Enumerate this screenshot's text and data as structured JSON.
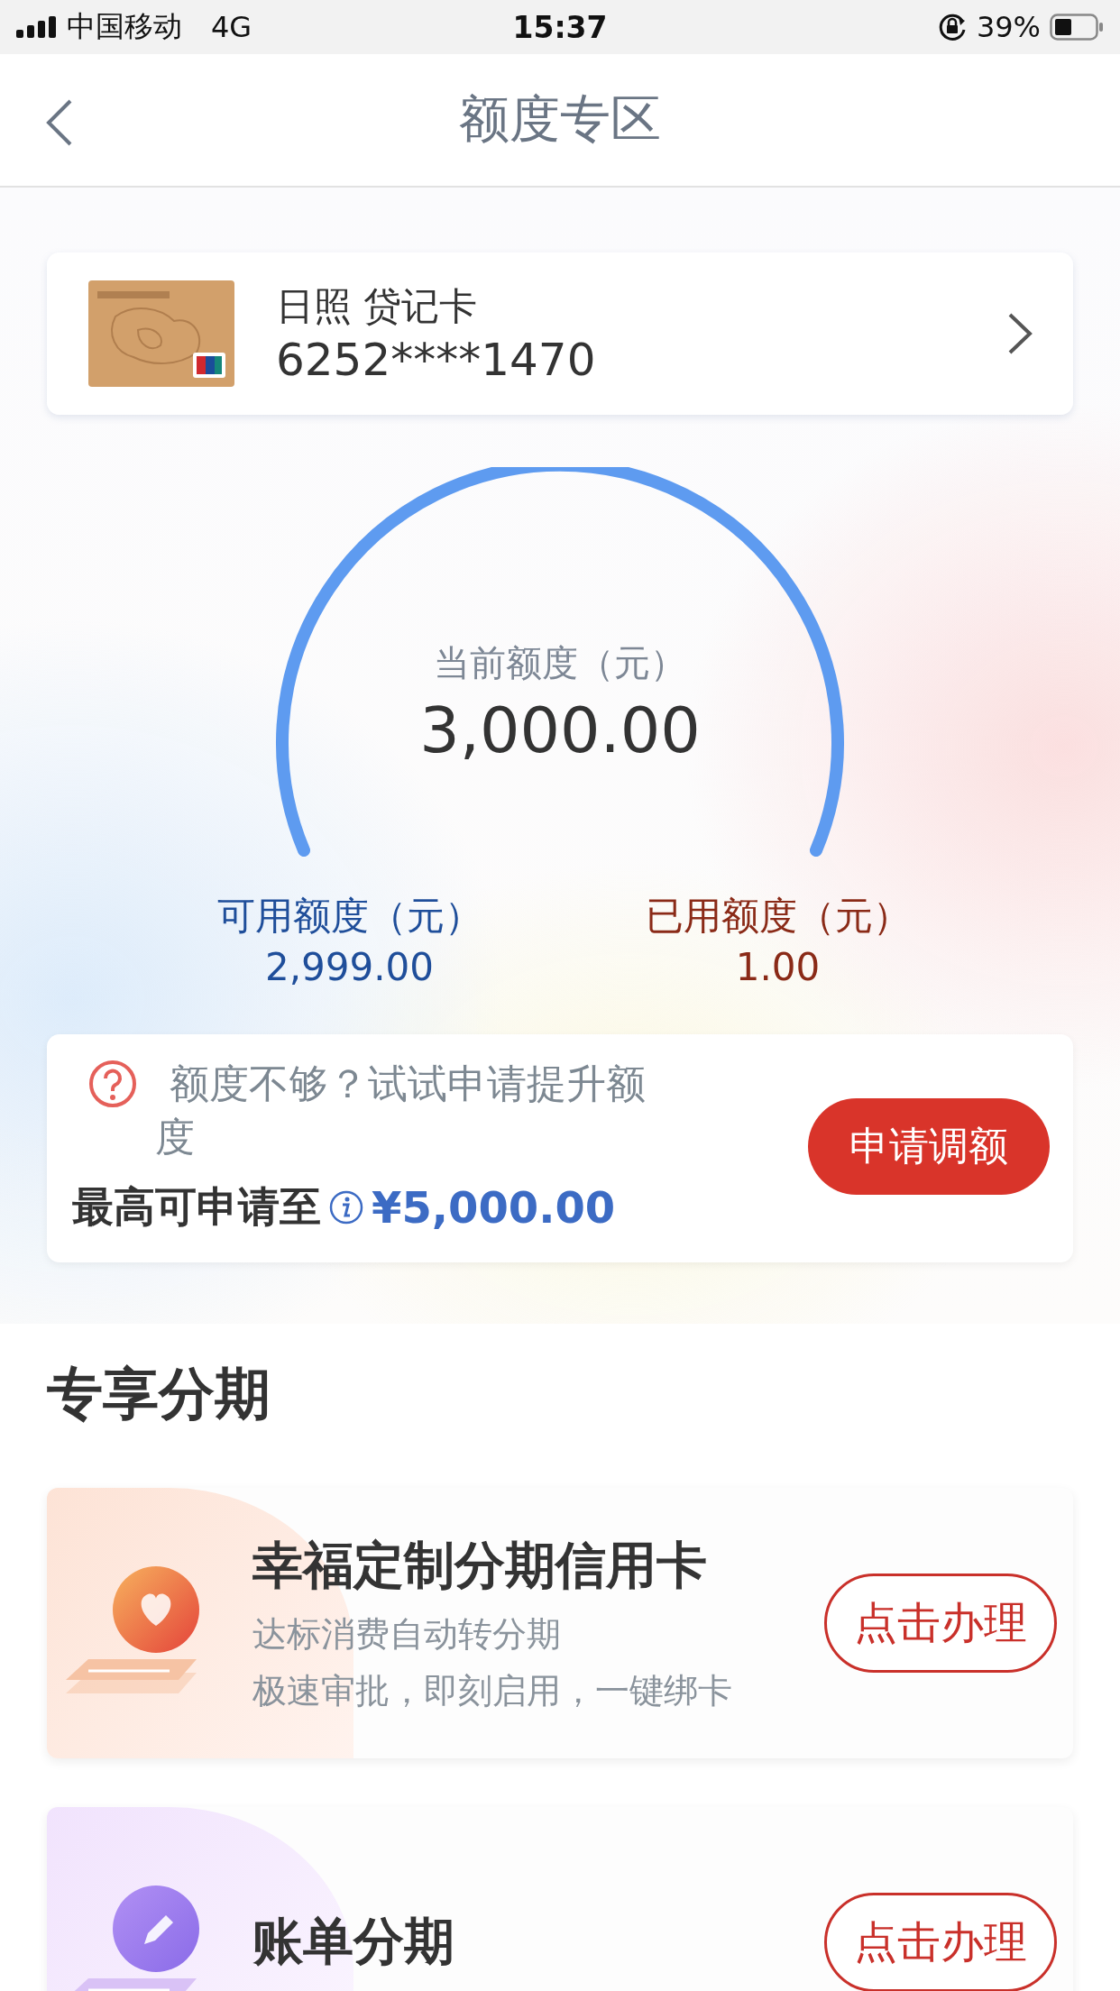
{
  "status_bar": {
    "carrier": "中国移动",
    "network": "4G",
    "time": "15:37",
    "battery": "39%"
  },
  "nav": {
    "title": "额度专区"
  },
  "card": {
    "name": "日照 贷记卡",
    "number": "6252****1470"
  },
  "gauge": {
    "label": "当前额度（元）",
    "value": "3,000.00"
  },
  "available": {
    "label": "可用额度（元）",
    "value": "2,999.00"
  },
  "used": {
    "label": "已用额度（元）",
    "value": "1.00"
  },
  "upgrade": {
    "prompt": "额度不够？试试申请提升额度",
    "max_label": "最高可申请至",
    "max_value": "¥5,000.00",
    "button": "申请调额"
  },
  "section_title": "专享分期",
  "offers": [
    {
      "kind": "heart",
      "title": "幸福定制分期信用卡",
      "lines": [
        "达标消费自动转分期",
        "极速审批，即刻启用，一键绑卡"
      ],
      "button": "点击办理"
    },
    {
      "kind": "pencil",
      "title": "账单分期",
      "button": "点击办理"
    }
  ]
}
